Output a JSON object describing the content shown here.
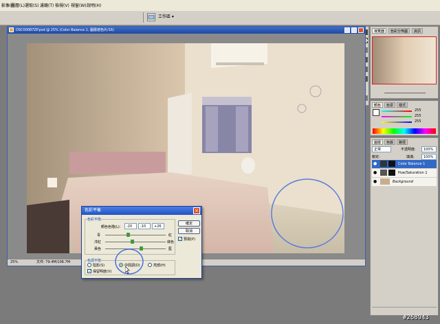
{
  "menubar": {
    "items": [
      "影像(I)",
      "圖層(L)",
      "選取(S)",
      "濾鏡(T)",
      "檢視(V)",
      "視窗(W)",
      "說明(H)"
    ]
  },
  "toolbar": {
    "workspace_label": "工作區 ▾"
  },
  "document": {
    "title": "DSC00087ZP.psd @ 25% (Color Balance 1, 圖層遮色片/16)",
    "zoom": "25%",
    "file_info": "文件: 79.4M/106.7M"
  },
  "navigator": {
    "tabs": [
      "導覽器",
      "色彩分佈圖",
      "資訊"
    ]
  },
  "color_panel": {
    "tabs": [
      "顏色",
      "色票",
      "樣式"
    ],
    "values": [
      "255",
      "255",
      "255"
    ]
  },
  "layers_panel": {
    "tabs": [
      "圖層",
      "色版",
      "路徑"
    ],
    "blend_mode": "正常",
    "opacity_label": "不透明度:",
    "opacity": "100%",
    "fill_label": "填滿:",
    "fill": "100%",
    "lock_label": "鎖定:",
    "layers": [
      {
        "name": "Color Balance 1",
        "selected": true
      },
      {
        "name": "Hue/Saturation 1",
        "selected": false
      },
      {
        "name": "Background",
        "selected": false
      }
    ]
  },
  "dialog": {
    "title": "色彩平衡",
    "balance_group": "色彩平衡",
    "levels_label": "顏色色階(L):",
    "levels": [
      "-20",
      "-10",
      "+26"
    ],
    "sliders": [
      {
        "left": "青",
        "right": "紅",
        "value": -20
      },
      {
        "left": "洋紅",
        "right": "綠色",
        "value": -10
      },
      {
        "left": "黃色",
        "right": "藍",
        "value": 26
      }
    ],
    "ok": "確定",
    "cancel": "取消",
    "preview": "預視(P)",
    "tone_group": "色調平衡",
    "tones": [
      {
        "label": "陰影(S)",
        "checked": false
      },
      {
        "label": "中間調(D)",
        "checked": true
      },
      {
        "label": "亮部(H)",
        "checked": false
      }
    ],
    "preserve": "保留明度(V)"
  },
  "watermark": "#268943"
}
